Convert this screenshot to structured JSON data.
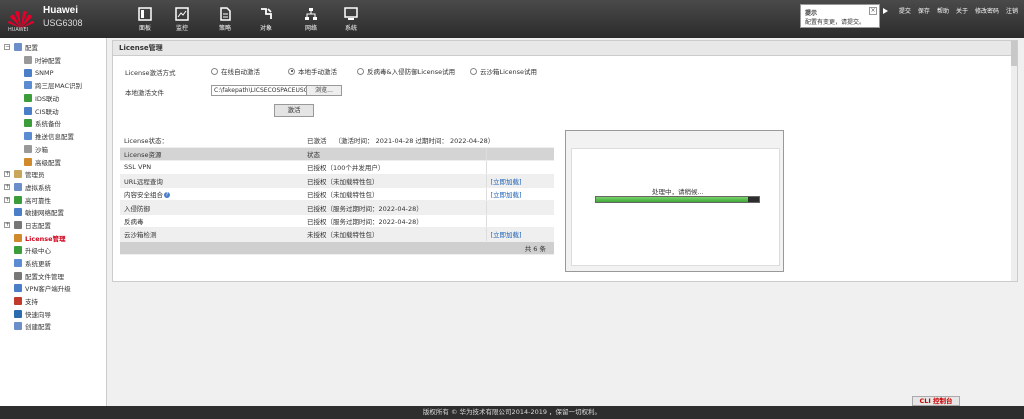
{
  "header": {
    "logo_text": "HUAWEI",
    "brand": "Huawei",
    "model": "USG6308",
    "nav": [
      {
        "label": "面板",
        "icon": "dashboard-icon"
      },
      {
        "label": "监控",
        "icon": "monitor-icon"
      },
      {
        "label": "策略",
        "icon": "policy-icon"
      },
      {
        "label": "对象",
        "icon": "object-icon"
      },
      {
        "label": "网络",
        "icon": "network-icon"
      },
      {
        "label": "系统",
        "icon": "system-icon"
      }
    ],
    "tip": {
      "title": "提示",
      "text": "配置有变更，请提交。",
      "close": "×"
    },
    "menu": [
      "提交",
      "保存",
      "帮助",
      "关于",
      "修改密码",
      "注销"
    ]
  },
  "sidebar": {
    "items": [
      {
        "label": "配置",
        "level": 0,
        "exp": "⊟",
        "color": "#6c8fc9"
      },
      {
        "label": "时钟配置",
        "level": 1,
        "color": "#999"
      },
      {
        "label": "SNMP",
        "level": 1,
        "color": "#4a7fc8"
      },
      {
        "label": "跨三层MAC识别",
        "level": 1,
        "color": "#5b8bd0"
      },
      {
        "label": "IDS联动",
        "level": 1,
        "color": "#3a9d3a"
      },
      {
        "label": "CIS联动",
        "level": 1,
        "color": "#4a7fc8"
      },
      {
        "label": "系统备份",
        "level": 1,
        "color": "#3a9d3a"
      },
      {
        "label": "推送信息配置",
        "level": 1,
        "color": "#5b8bd0"
      },
      {
        "label": "沙箱",
        "level": 1,
        "color": "#999"
      },
      {
        "label": "高级配置",
        "level": 1,
        "color": "#d08a2b"
      },
      {
        "label": "管理员",
        "level": 0,
        "exp": "⊞",
        "color": "#c9a75a"
      },
      {
        "label": "虚拟系统",
        "level": 0,
        "exp": "⊞",
        "color": "#6c8fc9"
      },
      {
        "label": "高可靠性",
        "level": 0,
        "exp": "⊞",
        "color": "#3a9d3a"
      },
      {
        "label": "敏捷网络配置",
        "level": 0,
        "color": "#4a7fc8"
      },
      {
        "label": "日志配置",
        "level": 0,
        "exp": "⊞",
        "color": "#777"
      },
      {
        "label": "License管理",
        "level": 0,
        "color": "#d08a2b",
        "active": true
      },
      {
        "label": "升级中心",
        "level": 0,
        "color": "#3a9d3a"
      },
      {
        "label": "系统更新",
        "level": 0,
        "color": "#5b8bd0"
      },
      {
        "label": "配置文件管理",
        "level": 0,
        "color": "#777"
      },
      {
        "label": "VPN客户端升级",
        "level": 0,
        "color": "#4a7fc8"
      },
      {
        "label": "支持",
        "level": 0,
        "color": "#c0392b"
      },
      {
        "label": "快速向导",
        "level": 0,
        "color": "#2b6cb0"
      },
      {
        "label": "创建配置",
        "level": 0,
        "color": "#6c8fc9"
      }
    ]
  },
  "main": {
    "title": "License管理",
    "mode_label": "License激活方式",
    "modes": [
      {
        "label": "在线自动激活",
        "checked": false
      },
      {
        "label": "本地手动激活",
        "checked": true
      },
      {
        "label": "反病毒&入侵防御License试用",
        "checked": false
      },
      {
        "label": "云沙箱License试用",
        "checked": false
      }
    ],
    "file_label": "本地激活文件",
    "file_value": "C:\\fakepath\\LICSECOSPACEUSG6300_V5",
    "browse_label": "浏览...",
    "activate_label": "激活",
    "status_label": "License状态：",
    "status_value": "已激活",
    "status_detail": "（激活时间：  2021-04-28  过期时间：  2022-04-28）",
    "table": {
      "headers": [
        "License资源",
        "状态",
        ""
      ],
      "rows": [
        {
          "name": "SSL VPN",
          "status": "已授权（100个并发用户）",
          "link": ""
        },
        {
          "name": "URL远程查询",
          "status": "已授权（未加载特性包）",
          "link": "[立即加载]"
        },
        {
          "name": "内容安全组合",
          "status": "已授权（未加载特性包）",
          "link": "[立即加载]",
          "help": "?"
        },
        {
          "name": "入侵防御",
          "status": "已授权（服务过期时间：2022-04-28）",
          "link": ""
        },
        {
          "name": "反病毒",
          "status": "已授权（服务过期时间：2022-04-28）",
          "link": ""
        },
        {
          "name": "云沙箱检测",
          "status": "未授权（未加载特性包）",
          "link": "[立即加载]"
        }
      ],
      "total": "共 6 条"
    },
    "dialog": {
      "message": "处理中，请稍候...",
      "progress": 0.93
    }
  },
  "cli_label": "CLI 控制台",
  "copyright": "版权所有 © 华为技术有限公司2014-2019 ，保留一切权利。"
}
